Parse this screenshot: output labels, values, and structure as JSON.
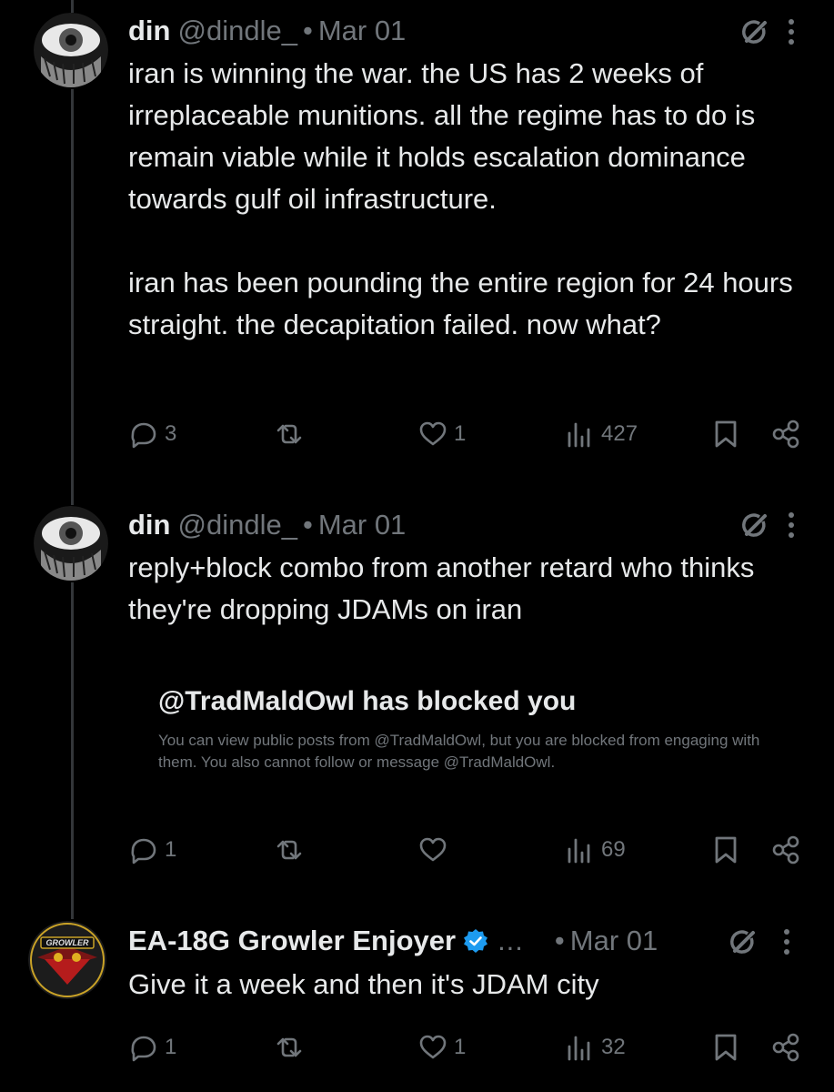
{
  "tweets": [
    {
      "name": "din",
      "handle": "@dindle_",
      "dot": "•",
      "date": "Mar 01",
      "text": "iran is winning the war. the US has 2 weeks of irreplaceable munitions. all the regime has to do is remain viable while it holds escalation dominance towards gulf oil infrastructure.\n\niran has been pounding the entire region for 24 hours straight. the decapitation failed. now what?",
      "replies": "3",
      "reposts": "",
      "likes": "1",
      "views": "427"
    },
    {
      "name": "din",
      "handle": "@dindle_",
      "dot": "•",
      "date": "Mar 01",
      "text": "reply+block combo from another retard who thinks they're dropping JDAMs on iran",
      "embed": {
        "title": "@TradMaldOwl has blocked you",
        "body": "You can view public posts from @TradMaldOwl, but you are blocked from engaging with them. You also cannot follow or message @TradMaldOwl."
      },
      "replies": "1",
      "reposts": "",
      "likes": "",
      "views": "69"
    },
    {
      "name": "EA-18G Growler Enjoyer",
      "ellipsis": "...",
      "dot": "•",
      "date": "Mar 01",
      "text": "Give it a week and then it's JDAM city",
      "replies": "1",
      "reposts": "",
      "likes": "1",
      "views": "32",
      "avatar_badge": "GROWLER"
    }
  ],
  "colors": {
    "background": "#000000",
    "text": "#e7e9ea",
    "muted": "#71767b",
    "verified": "#1d9bf0",
    "thread_line": "#333639"
  },
  "icons": [
    "reply-icon",
    "repost-icon",
    "like-icon",
    "views-icon",
    "bookmark-icon",
    "share-icon",
    "grok-icon",
    "more-icon",
    "verified-badge-icon"
  ]
}
